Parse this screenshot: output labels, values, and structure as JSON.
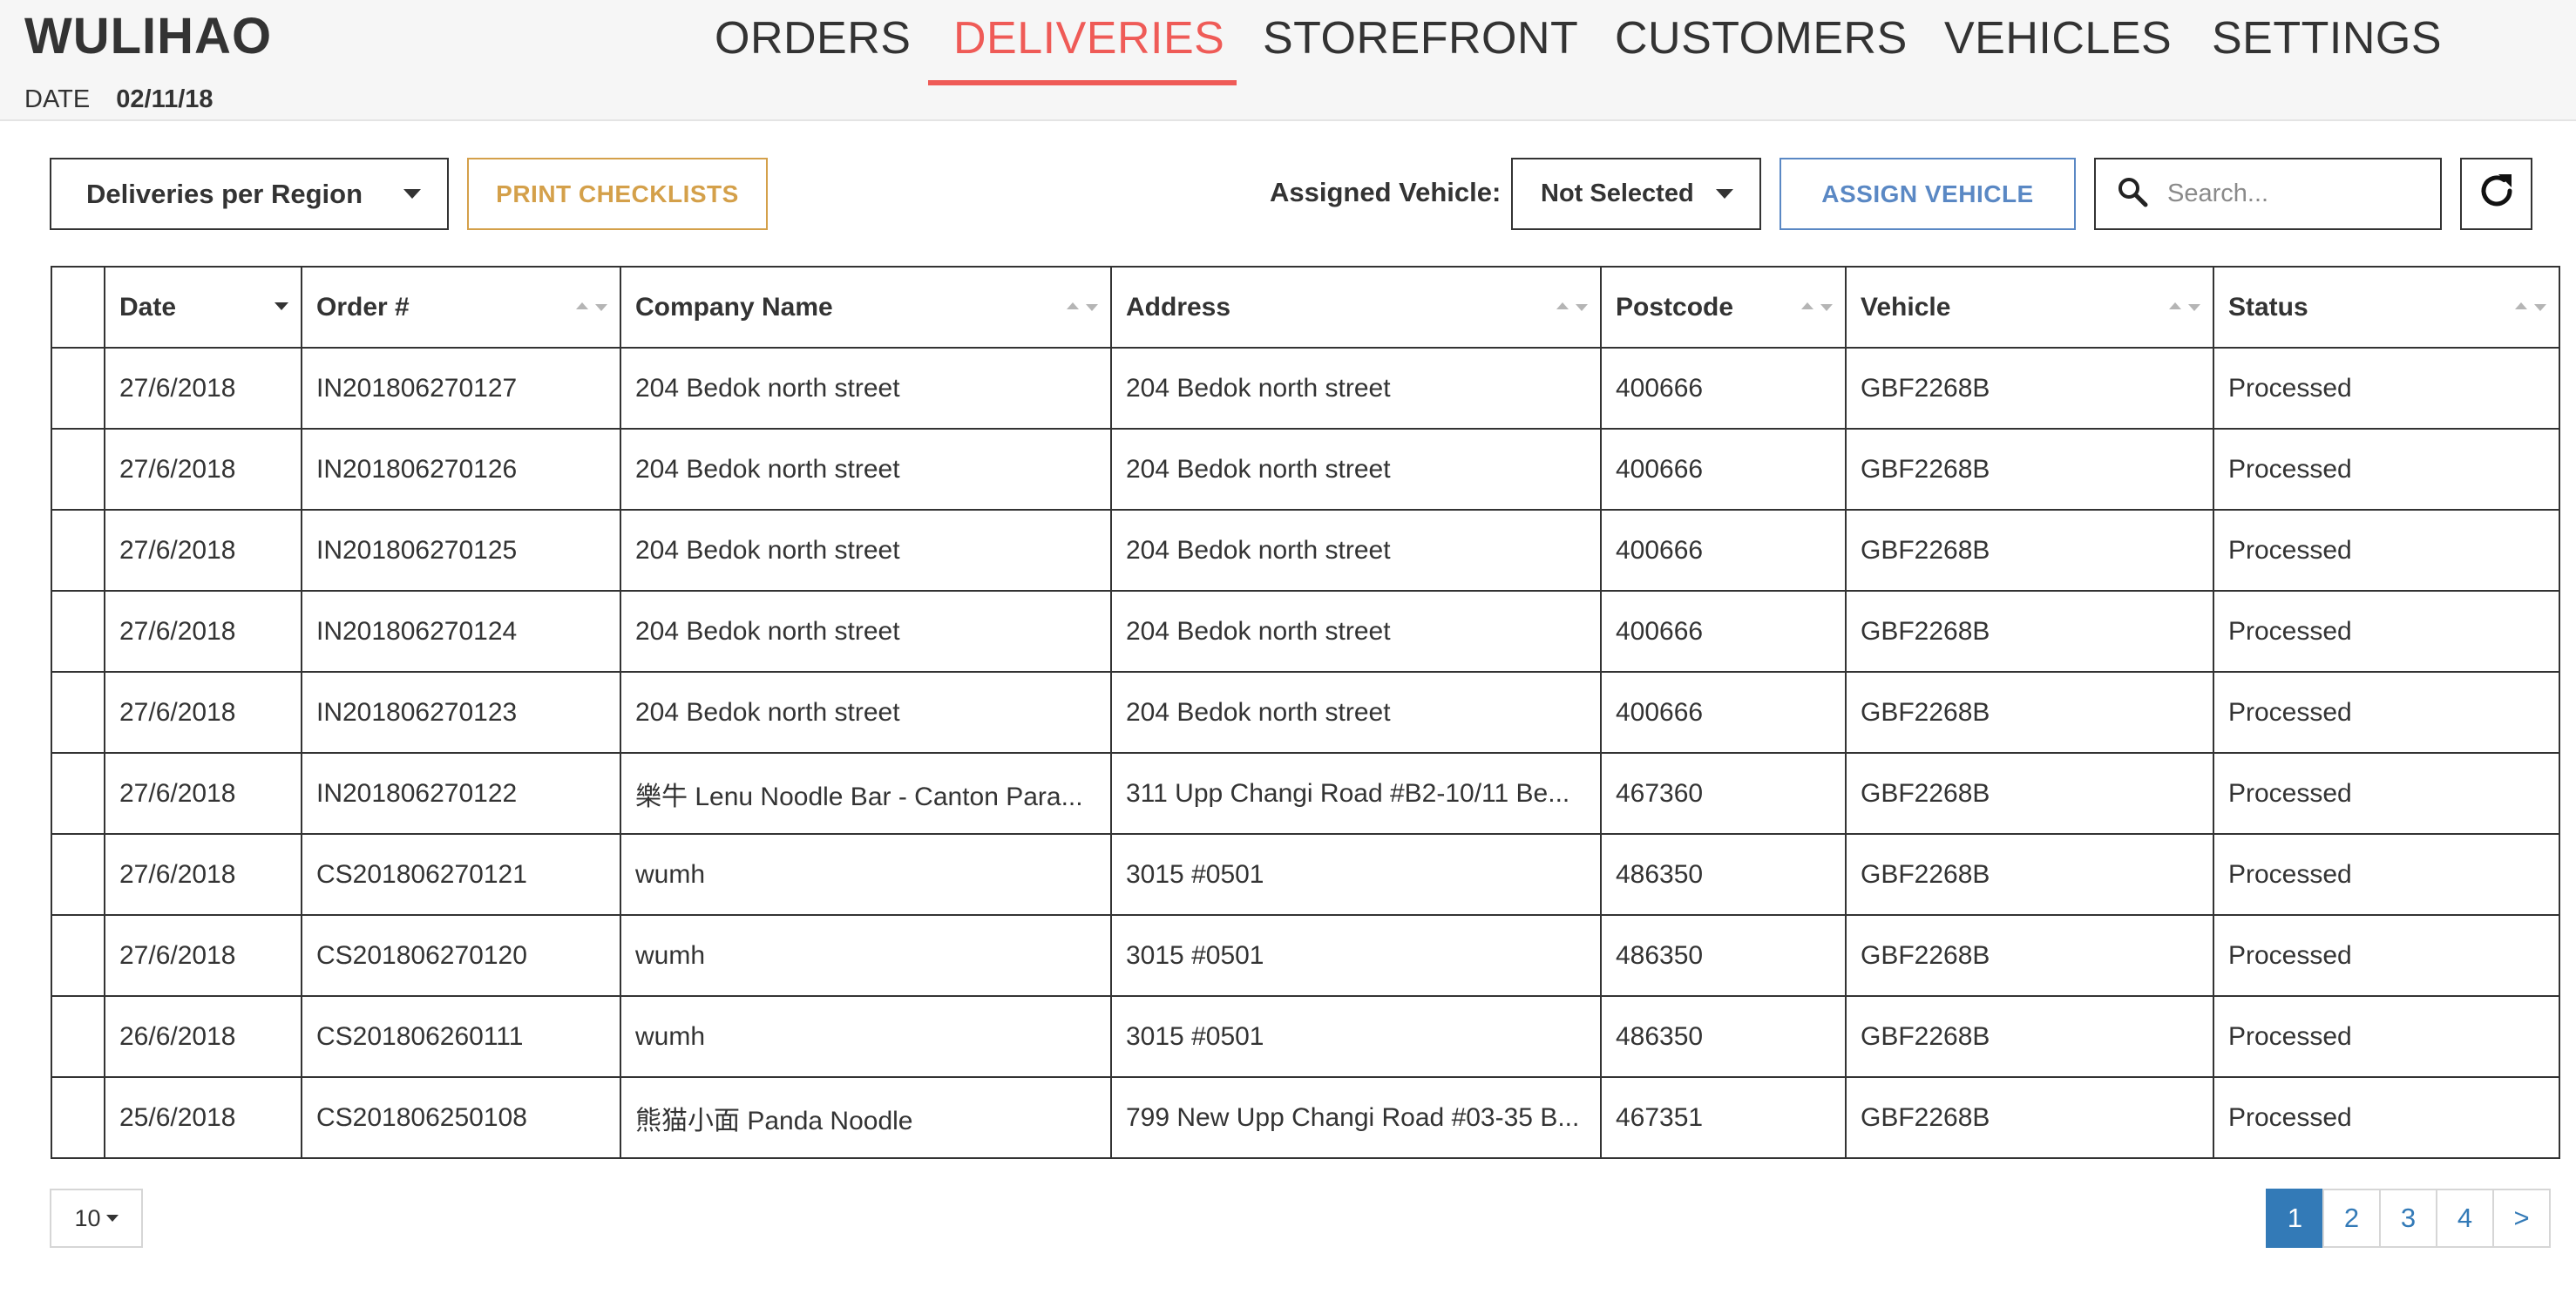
{
  "app": {
    "brand": "WULIHAO",
    "date_label": "DATE",
    "date_value": "02/11/18"
  },
  "nav": {
    "active": "DELIVERIES",
    "items": [
      "ORDERS",
      "DELIVERIES",
      "STOREFRONT",
      "CUSTOMERS",
      "VEHICLES",
      "SETTINGS"
    ]
  },
  "toolbar": {
    "region_select": "Deliveries per Region",
    "print_label": "PRINT CHECKLISTS",
    "assigned_label": "Assigned Vehicle:",
    "vehicle_select": "Not Selected",
    "assign_label": "ASSIGN VEHICLE",
    "search_placeholder": "Search...",
    "search_value": ""
  },
  "table": {
    "sorted_column": "Date",
    "sort_direction": "descending",
    "columns": [
      "",
      "Date",
      "Order #",
      "Company Name",
      "Address",
      "Postcode",
      "Vehicle",
      "Status"
    ],
    "rows": [
      [
        "",
        "27/6/2018",
        "IN201806270127",
        "204 Bedok north street",
        "204 Bedok north street",
        "400666",
        "GBF2268B",
        "Processed"
      ],
      [
        "",
        "27/6/2018",
        "IN201806270126",
        "204 Bedok north street",
        "204 Bedok north street",
        "400666",
        "GBF2268B",
        "Processed"
      ],
      [
        "",
        "27/6/2018",
        "IN201806270125",
        "204 Bedok north street",
        "204 Bedok north street",
        "400666",
        "GBF2268B",
        "Processed"
      ],
      [
        "",
        "27/6/2018",
        "IN201806270124",
        "204 Bedok north street",
        "204 Bedok north street",
        "400666",
        "GBF2268B",
        "Processed"
      ],
      [
        "",
        "27/6/2018",
        "IN201806270123",
        "204 Bedok north street",
        "204 Bedok north street",
        "400666",
        "GBF2268B",
        "Processed"
      ],
      [
        "",
        "27/6/2018",
        "IN201806270122",
        "樂牛 Lenu Noodle Bar - Canton Para...",
        "311 Upp Changi Road #B2-10/11 Be...",
        "467360",
        "GBF2268B",
        "Processed"
      ],
      [
        "",
        "27/6/2018",
        "CS201806270121",
        "wumh",
        "3015 #0501",
        "486350",
        "GBF2268B",
        "Processed"
      ],
      [
        "",
        "27/6/2018",
        "CS201806270120",
        "wumh",
        "3015 #0501",
        "486350",
        "GBF2268B",
        "Processed"
      ],
      [
        "",
        "26/6/2018",
        "CS201806260111",
        "wumh",
        "3015 #0501",
        "486350",
        "GBF2268B",
        "Processed"
      ],
      [
        "",
        "25/6/2018",
        "CS201806250108",
        "熊猫小面 Panda Noodle",
        "799 New Upp Changi Road #03-35 B...",
        "467351",
        "GBF2268B",
        "Processed"
      ]
    ]
  },
  "footer": {
    "page_size": "10",
    "pages": [
      "1",
      "2",
      "3",
      "4",
      ">"
    ],
    "current_page": "1"
  },
  "icons": {
    "search": "search-icon",
    "refresh": "refresh-icon",
    "dropdown": "caret-down-icon"
  },
  "colors": {
    "nav_active": "#ef5b57",
    "print_button": "#d4a04a",
    "assign_button": "#5a88c4",
    "pagination_active": "#337ab7"
  }
}
